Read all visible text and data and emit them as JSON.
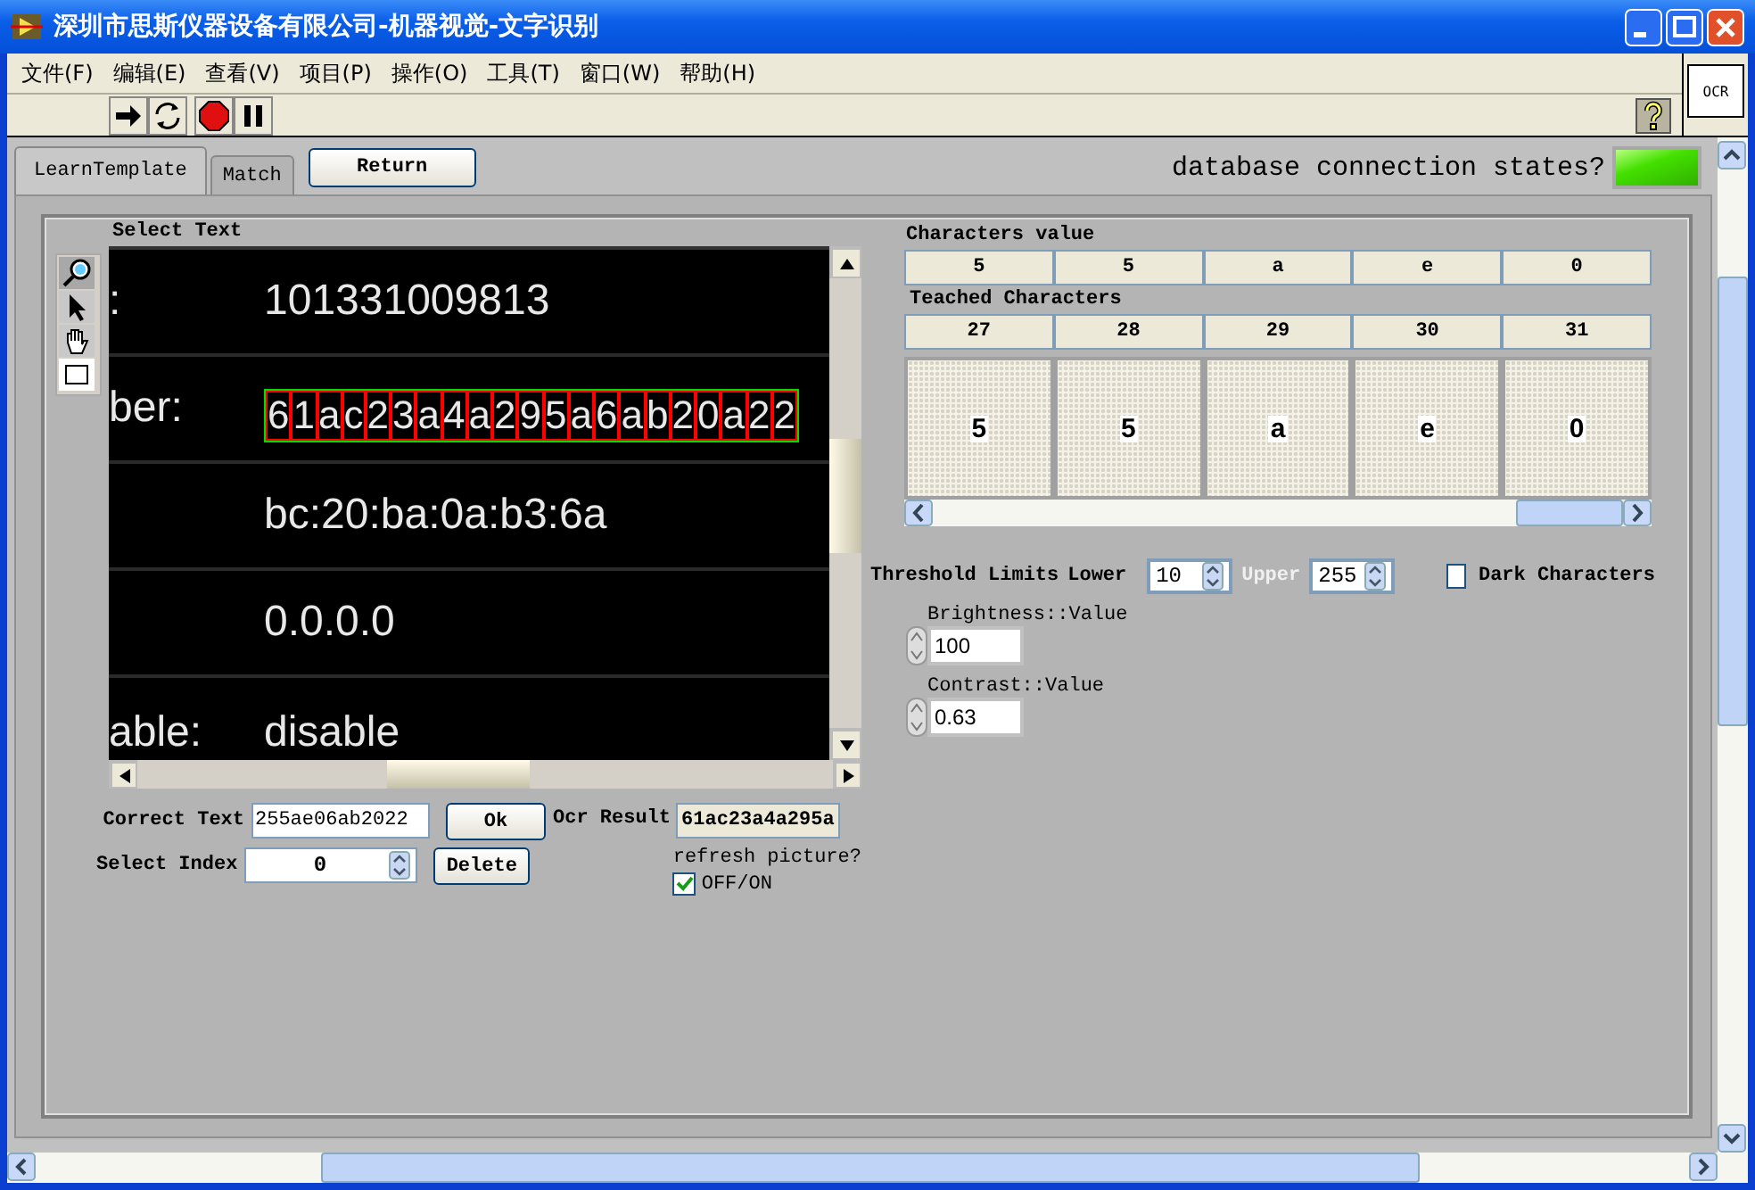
{
  "window": {
    "title": "深圳市思斯仪器设备有限公司-机器视觉-文字识别"
  },
  "menu": [
    {
      "label": "文件(F)"
    },
    {
      "label": "编辑(E)"
    },
    {
      "label": "查看(V)"
    },
    {
      "label": "项目(P)"
    },
    {
      "label": "操作(O)"
    },
    {
      "label": "工具(T)"
    },
    {
      "label": "窗口(W)"
    },
    {
      "label": "帮助(H)"
    }
  ],
  "toolbar": [
    {
      "kind": "run"
    },
    {
      "kind": "run-continuous"
    },
    {
      "kind": "abort"
    },
    {
      "kind": "pause"
    }
  ],
  "ocr_badge": "OCR",
  "tabs": [
    {
      "label": "LearnTemplate",
      "selected": true
    },
    {
      "label": "Match",
      "selected": false
    }
  ],
  "return_button": "Return",
  "db_status": {
    "label": "database connection states?",
    "on": true
  },
  "select_text": {
    "label": "Select Text",
    "tools": [
      {
        "kind": "zoom",
        "selected": true
      },
      {
        "kind": "pointer",
        "selected": false
      },
      {
        "kind": "pan",
        "selected": false
      },
      {
        "kind": "rectangle",
        "selected": false
      }
    ],
    "lines": [
      {
        "label": ":",
        "value": "101331009813",
        "selected": false
      },
      {
        "label": "ber:",
        "value": "61ac23a4a295a6ab20a22",
        "selected": true
      },
      {
        "value": "bc:20:ba:0a:b3:6a",
        "selected": false
      },
      {
        "value": "0.0.0.0",
        "selected": false
      },
      {
        "label": "able:",
        "value": "disable",
        "selected": false
      }
    ]
  },
  "correct_text": {
    "label": "Correct Text",
    "value": "255ae06ab2022"
  },
  "ok_button": "Ok",
  "ocr_result": {
    "label": "Ocr Result",
    "value": "61ac23a4a295a"
  },
  "select_index": {
    "label": "Select Index",
    "value": "0"
  },
  "delete_button": "Delete",
  "refresh": {
    "label": "refresh picture?",
    "option": "OFF/ON",
    "checked": true
  },
  "characters_value": {
    "label": "Characters value",
    "cells": [
      "5",
      "5",
      "a",
      "e",
      "0"
    ]
  },
  "teached": {
    "label": "Teached Characters",
    "indices": [
      "27",
      "28",
      "29",
      "30",
      "31"
    ],
    "tiles": [
      {
        "glyph": "5"
      },
      {
        "glyph": "5"
      },
      {
        "glyph": "a"
      },
      {
        "glyph": "e"
      },
      {
        "glyph": "0"
      }
    ]
  },
  "threshold": {
    "label": "Threshold Limits",
    "lower_label": "Lower",
    "lower": "10",
    "upper_label": "Upper",
    "upper": "255"
  },
  "dark_characters": {
    "label": "Dark Characters",
    "checked": false
  },
  "brightness": {
    "label": "Brightness::Value",
    "value": "100"
  },
  "contrast": {
    "label": "Contrast::Value",
    "value": "0.63"
  }
}
